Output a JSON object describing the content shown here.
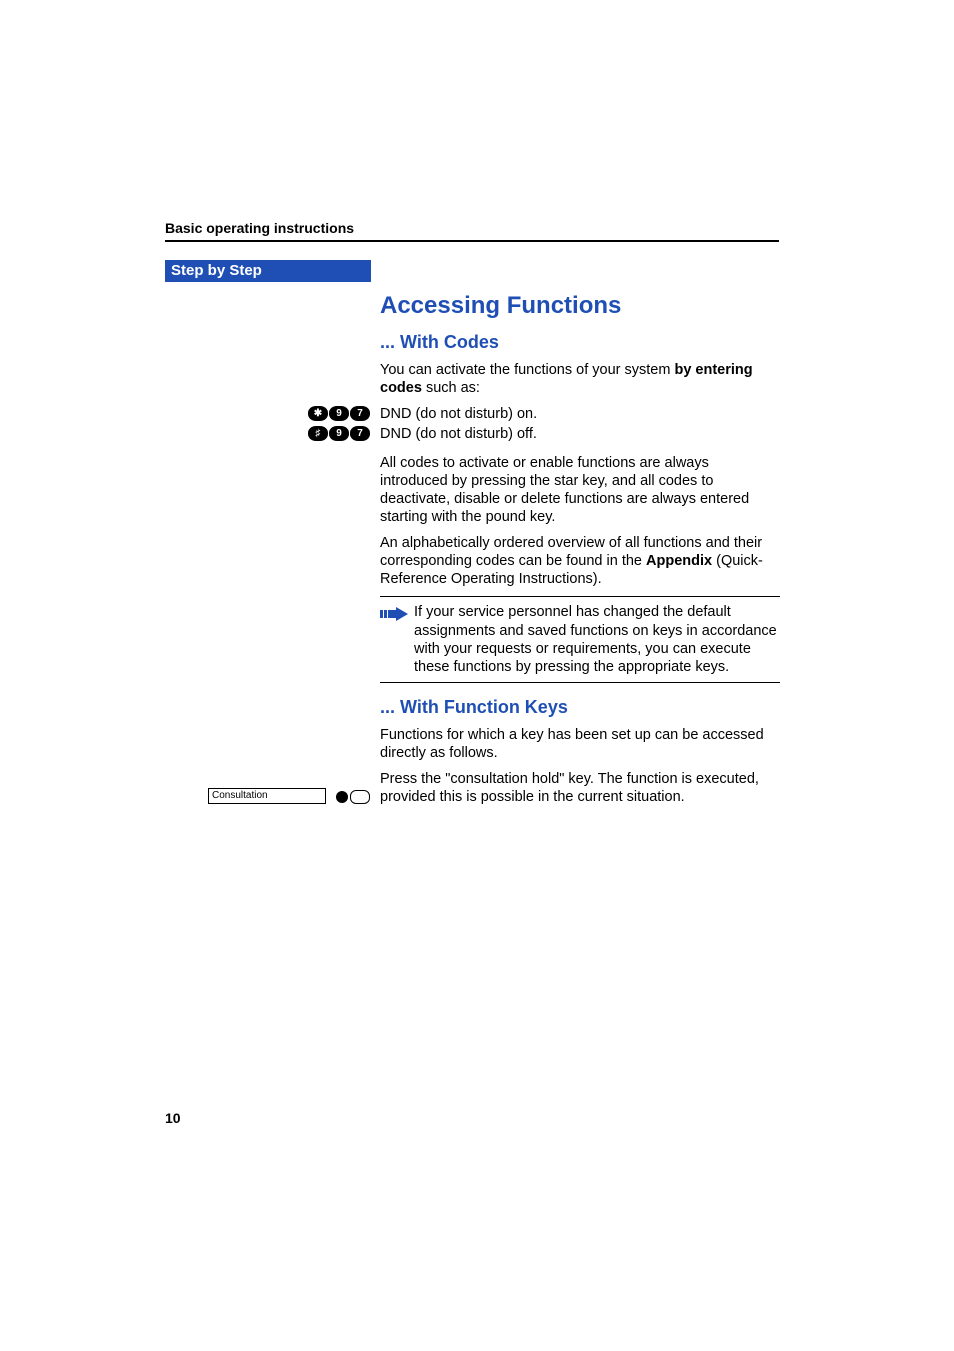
{
  "running_head": "Basic operating instructions",
  "sidebar_title": "Step by Step",
  "h1": "Accessing Functions",
  "sec_codes": {
    "heading": "... With Codes",
    "intro_pre": "You can activate the functions of your system ",
    "intro_bold": "by entering codes",
    "intro_post": " such as:",
    "row1": {
      "keys": [
        "✱",
        "9",
        "7"
      ],
      "text": "DND (do not disturb) on."
    },
    "row2": {
      "keys": [
        "♯",
        "9",
        "7"
      ],
      "text": "DND (do not disturb) off."
    },
    "para2": "All codes to activate or enable functions are always introduced by pressing the star key, and all codes to deactivate, disable or delete functions are always entered starting with the pound key.",
    "para3_pre": "An alphabetically ordered overview of all functions and their corresponding codes can be found in the ",
    "para3_bold": "Appendix",
    "para3_post": " (Quick-Reference Operating Instructions).",
    "note": "If your service personnel has changed the default assignments and saved functions on keys in accordance with your requests or requirements, you can execute these functions by pressing the appropriate keys."
  },
  "sec_funckeys": {
    "heading": "... With Function Keys",
    "para1": "Functions for which a key has been set up can be accessed directly as follows.",
    "margin_label": "Consultation",
    "para2": "Press the \"consultation hold\" key. The function is executed, provided this is possible in the current situation."
  },
  "page_number": "10"
}
